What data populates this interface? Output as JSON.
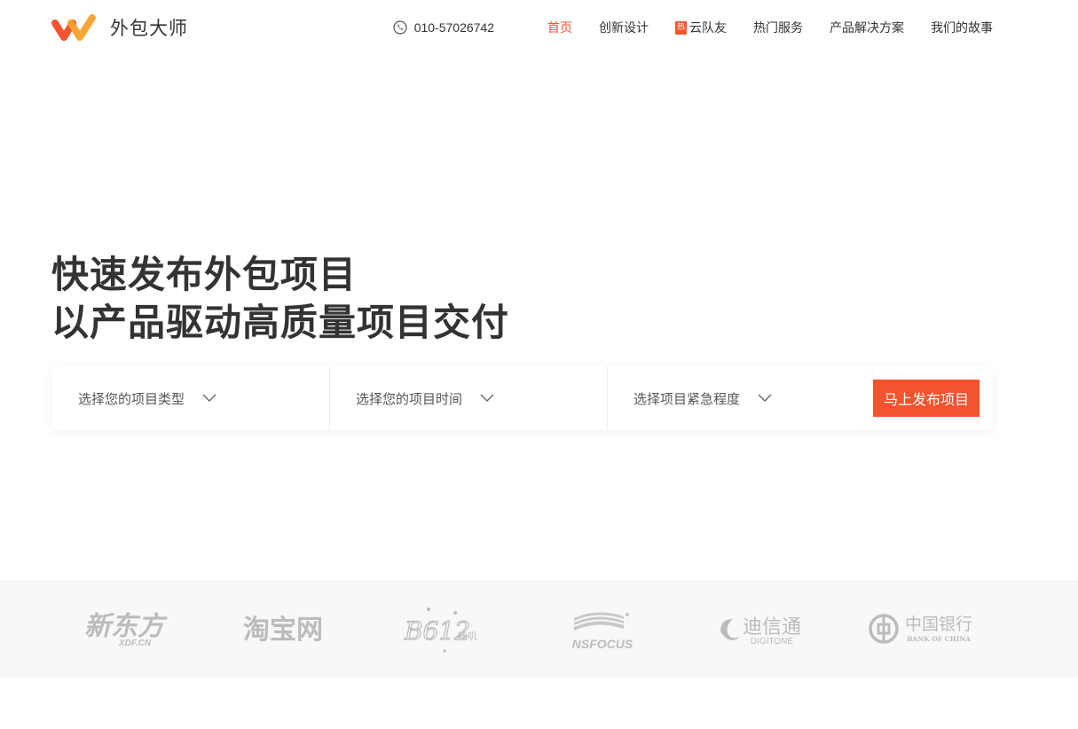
{
  "brand": {
    "name": "外包大师",
    "accent": "#f3532d",
    "accent2": "#f7a02c"
  },
  "header": {
    "phone": "010-57026742",
    "nav": [
      {
        "label": "首页",
        "active": true
      },
      {
        "label": "创新设计"
      },
      {
        "label": "云队友",
        "badge": "热"
      },
      {
        "label": "热门服务"
      },
      {
        "label": "产品解决方案"
      },
      {
        "label": "我们的故事"
      }
    ]
  },
  "hero": {
    "title": "快速发布外包项目",
    "subtitle": "以产品驱动高质量项目交付"
  },
  "search": {
    "type_placeholder": "选择您的项目类型",
    "time_placeholder": "选择您的项目时间",
    "urgency_placeholder": "选择项目紧急程度",
    "submit_label": "马上发布项目"
  },
  "partners": {
    "xdf": {
      "main": "新东方",
      "sub": "XDF.CN"
    },
    "taobao": {
      "main": "淘宝网"
    },
    "b612": {
      "main": "B612",
      "sub": "咔叽"
    },
    "nsfocus": {
      "main": "NSFOCUS"
    },
    "digitone": {
      "main": "迪信通",
      "sub": "DIGITONE"
    },
    "boc": {
      "main": "中国银行",
      "sub": "BANK OF CHINA"
    }
  }
}
